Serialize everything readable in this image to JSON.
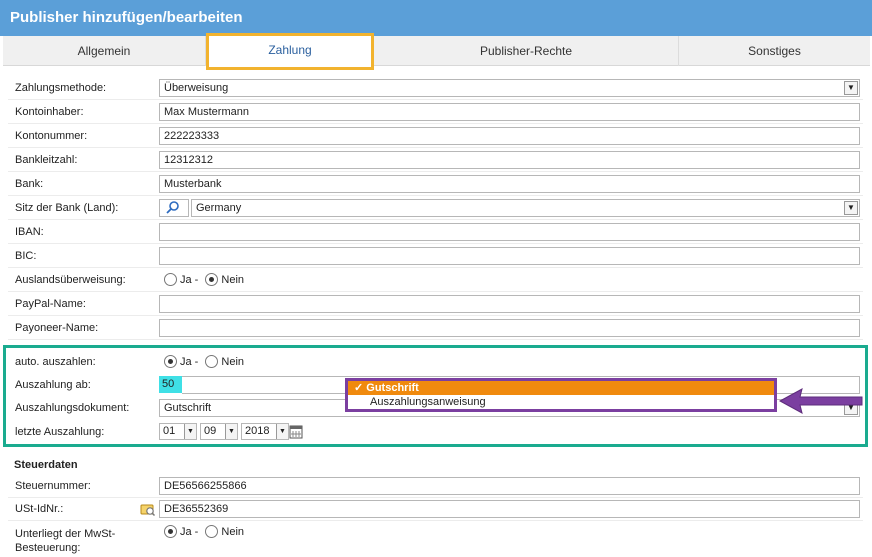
{
  "window": {
    "title": "Publisher hinzufügen/bearbeiten"
  },
  "tabs": [
    {
      "label": "Allgemein"
    },
    {
      "label": "Zahlung"
    },
    {
      "label": "Publisher-Rechte"
    },
    {
      "label": "Sonstiges"
    }
  ],
  "payment": {
    "method": {
      "label": "Zahlungsmethode:",
      "value": "Überweisung"
    },
    "holder": {
      "label": "Kontoinhaber:",
      "value": "Max Mustermann"
    },
    "account": {
      "label": "Kontonummer:",
      "value": "222223333"
    },
    "bankcode": {
      "label": "Bankleitzahl:",
      "value": "12312312"
    },
    "bank": {
      "label": "Bank:",
      "value": "Musterbank"
    },
    "bank_country": {
      "label": "Sitz der Bank (Land):",
      "value": "Germany"
    },
    "iban": {
      "label": "IBAN:",
      "value": ""
    },
    "bic": {
      "label": "BIC:",
      "value": ""
    },
    "foreign": {
      "label": "Auslandsüberweisung:",
      "yes": "Ja -",
      "no": "Nein"
    },
    "paypal": {
      "label": "PayPal-Name:",
      "value": ""
    },
    "payoneer": {
      "label": "Payoneer-Name:",
      "value": ""
    }
  },
  "payout": {
    "auto": {
      "label": "auto. auszahlen:",
      "yes": "Ja -",
      "no": "Nein"
    },
    "threshold": {
      "label": "Auszahlung ab:",
      "value": "50"
    },
    "document": {
      "label": "Auszahlungsdokument:",
      "value": "Gutschrift"
    },
    "last": {
      "label": "letzte Auszahlung:",
      "day": "01",
      "month": "09",
      "year": "2018"
    },
    "dropdown_options": [
      {
        "label": "Gutschrift",
        "check": "✓"
      },
      {
        "label": "Auszahlungsanweisung",
        "check": ""
      }
    ]
  },
  "tax": {
    "heading": "Steuerdaten",
    "tax_number": {
      "label": "Steuernummer:",
      "value": "DE56566255866"
    },
    "vat_id": {
      "label": "USt-IdNr.:",
      "value": "DE36552369"
    },
    "vat_liable": {
      "label_line1": "Unterliegt der MwSt-",
      "label_line2": "Besteuerung:",
      "yes": "Ja -",
      "no": "Nein"
    }
  },
  "colors": {
    "title_bg": "#5b9fd8",
    "tab_highlight": "#f2b32e",
    "section_highlight": "#1aab8f",
    "dropdown_highlight": "#7b3fa0",
    "selected_option": "#f08a0e",
    "threshold_bg": "#3fe0e6"
  },
  "icons": [
    "search-icon",
    "calendar-icon",
    "lookup-icon",
    "arrow-icon"
  ]
}
